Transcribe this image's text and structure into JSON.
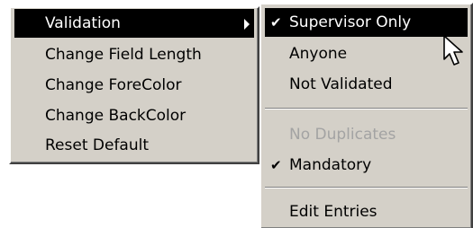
{
  "main_menu": {
    "items": [
      {
        "label": "Validation",
        "has_submenu": true,
        "highlighted": true
      },
      {
        "label": "Change Field Length"
      },
      {
        "label": "Change ForeColor"
      },
      {
        "label": "Change BackColor"
      },
      {
        "label": "Reset Default"
      }
    ]
  },
  "submenu": {
    "items": [
      {
        "label": "Supervisor Only",
        "checked": true,
        "highlighted": true
      },
      {
        "label": "Anyone"
      },
      {
        "label": "Not Validated"
      },
      {
        "label": "No Duplicates",
        "disabled": true
      },
      {
        "label": "Mandatory",
        "checked": true
      },
      {
        "label": "Edit Entries"
      }
    ],
    "check_glyph": "✔"
  },
  "colors": {
    "menu_bg": "#d4d0c8",
    "highlight_bg": "#000000",
    "highlight_fg": "#ffffff",
    "disabled_fg": "#a3a3a3"
  },
  "icons": {
    "cursor": "arrow-cursor-icon",
    "submenu_arrow": "submenu-arrow-icon",
    "check": "checkmark-icon"
  }
}
